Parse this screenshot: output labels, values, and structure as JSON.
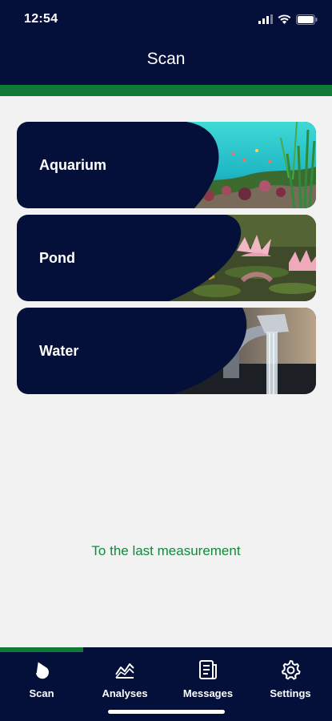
{
  "status_bar": {
    "time": "12:54",
    "icons": [
      "cellular-signal-icon",
      "wifi-icon",
      "battery-icon"
    ]
  },
  "header": {
    "title": "Scan"
  },
  "cards": [
    {
      "label": "Aquarium",
      "image": "aquarium-photo"
    },
    {
      "label": "Pond",
      "image": "pond-photo"
    },
    {
      "label": "Water",
      "image": "water-tap-photo"
    }
  ],
  "last_measurement_link": "To the last measurement",
  "tabbar": {
    "active": "Scan",
    "tabs": [
      {
        "label": "Scan",
        "icon": "droplet-icon"
      },
      {
        "label": "Analyses",
        "icon": "chart-icon"
      },
      {
        "label": "Messages",
        "icon": "messages-icon"
      },
      {
        "label": "Settings",
        "icon": "gear-icon"
      }
    ]
  },
  "colors": {
    "navy": "#04103a",
    "green": "#0f7a37",
    "link_green": "#108a3c",
    "background": "#f2f2f2"
  }
}
